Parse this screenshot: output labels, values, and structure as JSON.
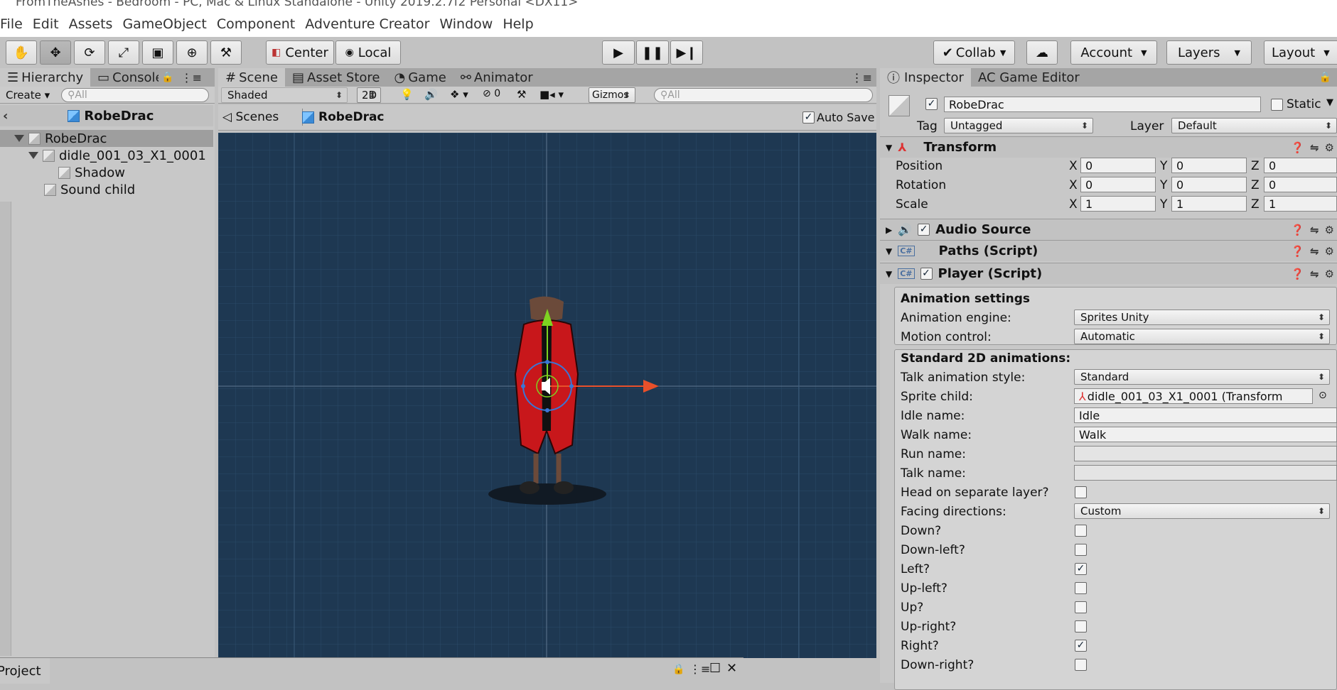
{
  "window": {
    "title": "FromTheAshes - Bedroom - PC, Mac & Linux Standalone - Unity 2019.2.7f2 Personal <DX11>"
  },
  "menu": [
    "File",
    "Edit",
    "Assets",
    "GameObject",
    "Component",
    "Adventure Creator",
    "Window",
    "Help"
  ],
  "toolbar": {
    "pivot_label": "Center",
    "space_label": "Local",
    "collab_label": "Collab",
    "account_label": "Account",
    "layers_label": "Layers",
    "layout_label": "Layout"
  },
  "hierarchy": {
    "tabs": [
      "Hierarchy",
      "Console"
    ],
    "create_label": "Create",
    "search_placeholder": "All",
    "scene_name": "RobeDrac",
    "items": [
      {
        "label": "RobeDrac"
      },
      {
        "label": "didle_001_03_X1_0001"
      },
      {
        "label": "Shadow"
      },
      {
        "label": "Sound child"
      }
    ]
  },
  "scene": {
    "tabs": [
      "Scene",
      "Asset Store",
      "Game",
      "Animator"
    ],
    "shading": "Shaded",
    "mode_2d": "2D",
    "hidden_count": "0",
    "gizmos_label": "Gizmos",
    "search_placeholder": "All",
    "breadcrumb_root": "Scenes",
    "breadcrumb_prefab": "RobeDrac",
    "auto_save_label": "Auto Save",
    "auto_save_checked": true
  },
  "inspector": {
    "tabs": [
      "Inspector",
      "AC Game Editor"
    ],
    "object_name": "RobeDrac",
    "static_label": "Static",
    "tag_label": "Tag",
    "tag_value": "Untagged",
    "layer_label": "Layer",
    "layer_value": "Default",
    "transform": {
      "title": "Transform",
      "rows": [
        {
          "label": "Position",
          "x": "0",
          "y": "0",
          "z": "0"
        },
        {
          "label": "Rotation",
          "x": "0",
          "y": "0",
          "z": "0"
        },
        {
          "label": "Scale",
          "x": "1",
          "y": "1",
          "z": "1"
        }
      ]
    },
    "components": [
      "Audio Source",
      "Paths (Script)",
      "Player (Script)"
    ],
    "animation_settings": {
      "title": "Animation settings",
      "engine_label": "Animation engine:",
      "engine_value": "Sprites Unity",
      "motion_label": "Motion control:",
      "motion_value": "Automatic"
    },
    "standard2d": {
      "title": "Standard 2D animations:",
      "talk_style_label": "Talk animation style:",
      "talk_style_value": "Standard",
      "sprite_child_label": "Sprite child:",
      "sprite_child_value": "didle_001_03_X1_0001 (Transform",
      "idle_label": "Idle name:",
      "idle_value": "Idle",
      "walk_label": "Walk name:",
      "walk_value": "Walk",
      "run_label": "Run name:",
      "run_value": "",
      "talk_label": "Talk name:",
      "talk_value": "",
      "head_label": "Head on separate layer?",
      "facing_label": "Facing directions:",
      "facing_value": "Custom",
      "directions": [
        {
          "label": "Down?",
          "checked": false
        },
        {
          "label": "Down-left?",
          "checked": false
        },
        {
          "label": "Left?",
          "checked": true
        },
        {
          "label": "Up-left?",
          "checked": false
        },
        {
          "label": "Up?",
          "checked": false
        },
        {
          "label": "Up-right?",
          "checked": false
        },
        {
          "label": "Right?",
          "checked": true
        },
        {
          "label": "Down-right?",
          "checked": false
        }
      ]
    }
  },
  "project": {
    "tab": "Project"
  },
  "colors": {
    "viewport": "#1e3852",
    "robe": "#c8171b",
    "axis_x": "#e8502a",
    "axis_y": "#7ed321"
  }
}
